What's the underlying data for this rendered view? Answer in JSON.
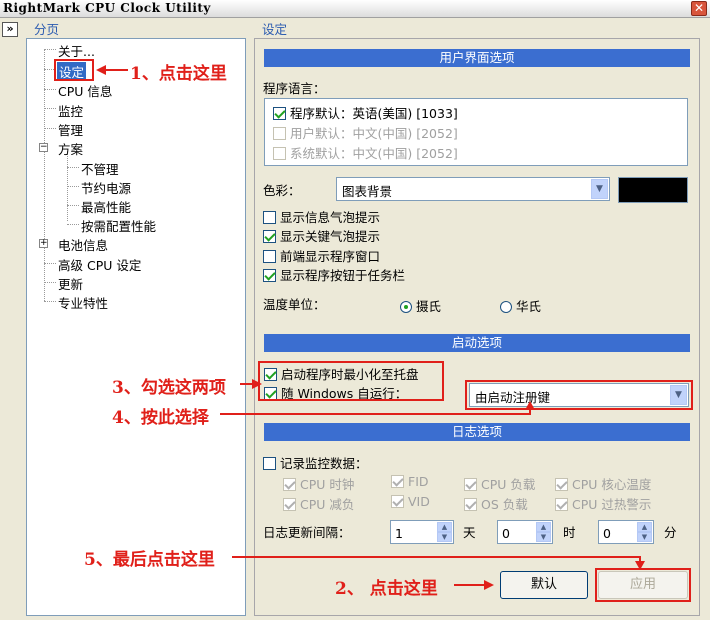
{
  "window": {
    "title": "RightMark CPU Clock Utility",
    "close_glyph": "✕"
  },
  "collapse_glyph": "»",
  "left_pane": {
    "title": "分页",
    "items": [
      {
        "label": "关于..."
      },
      {
        "label": "设定"
      },
      {
        "label": "CPU 信息"
      },
      {
        "label": "监控"
      },
      {
        "label": "管理"
      },
      {
        "label": "方案"
      },
      {
        "label": "不管理"
      },
      {
        "label": "节约电源"
      },
      {
        "label": "最高性能"
      },
      {
        "label": "按需配置性能"
      },
      {
        "label": "电池信息"
      },
      {
        "label": "高级 CPU 设定"
      },
      {
        "label": "更新"
      },
      {
        "label": "专业特性"
      }
    ],
    "expander_minus": "−",
    "expander_plus": "+"
  },
  "right_pane": {
    "title": "设定",
    "ui_section": {
      "header": "用户界面选项",
      "language_label": "程序语言：",
      "languages": [
        {
          "label": "程序默认：英语(美国) [1033]"
        },
        {
          "label": "用户默认：中文(中国) [2052]"
        },
        {
          "label": "系统默认：中文(中国) [2052]"
        }
      ],
      "color_label": "色彩：",
      "color_value": "图表背景",
      "color_swatch": "#000000",
      "options": [
        {
          "label": "显示信息气泡提示"
        },
        {
          "label": "显示关键气泡提示"
        },
        {
          "label": "前端显示程序窗口"
        },
        {
          "label": "显示程序按钮于任务栏"
        }
      ],
      "temp_label": "温度单位：",
      "temp_celsius": "摄氏",
      "temp_fahrenheit": "华氏"
    },
    "startup_section": {
      "header": "启动选项",
      "minimize_to_tray": "启动程序时最小化至托盘",
      "autorun": "随 Windows 自运行：",
      "autorun_method": "由启动注册键"
    },
    "log_section": {
      "header": "日志选项",
      "record_label": "记录监控数据：",
      "fields": [
        {
          "label": "CPU 时钟"
        },
        {
          "label": "FID"
        },
        {
          "label": "CPU 负载"
        },
        {
          "label": "CPU 核心温度"
        },
        {
          "label": "CPU 减负"
        },
        {
          "label": "VID"
        },
        {
          "label": "OS 负载"
        },
        {
          "label": "CPU 过热警示"
        }
      ],
      "interval_label": "日志更新间隔：",
      "days_value": "1",
      "days_unit": "天",
      "hours_value": "0",
      "hours_unit": "时",
      "minutes_value": "0",
      "minutes_unit": "分"
    },
    "buttons": {
      "default": "默认",
      "apply": "应用"
    }
  },
  "annotations": {
    "step1": "1、点击这里",
    "step2": "2、 点击这里",
    "step3": "3、勾选这两项",
    "step4": "4、按此选择",
    "step5": "5、最后点击这里"
  },
  "colors": {
    "accent": "#3b6ed0",
    "annotation": "#e0201a",
    "selected": "#316ac5"
  }
}
